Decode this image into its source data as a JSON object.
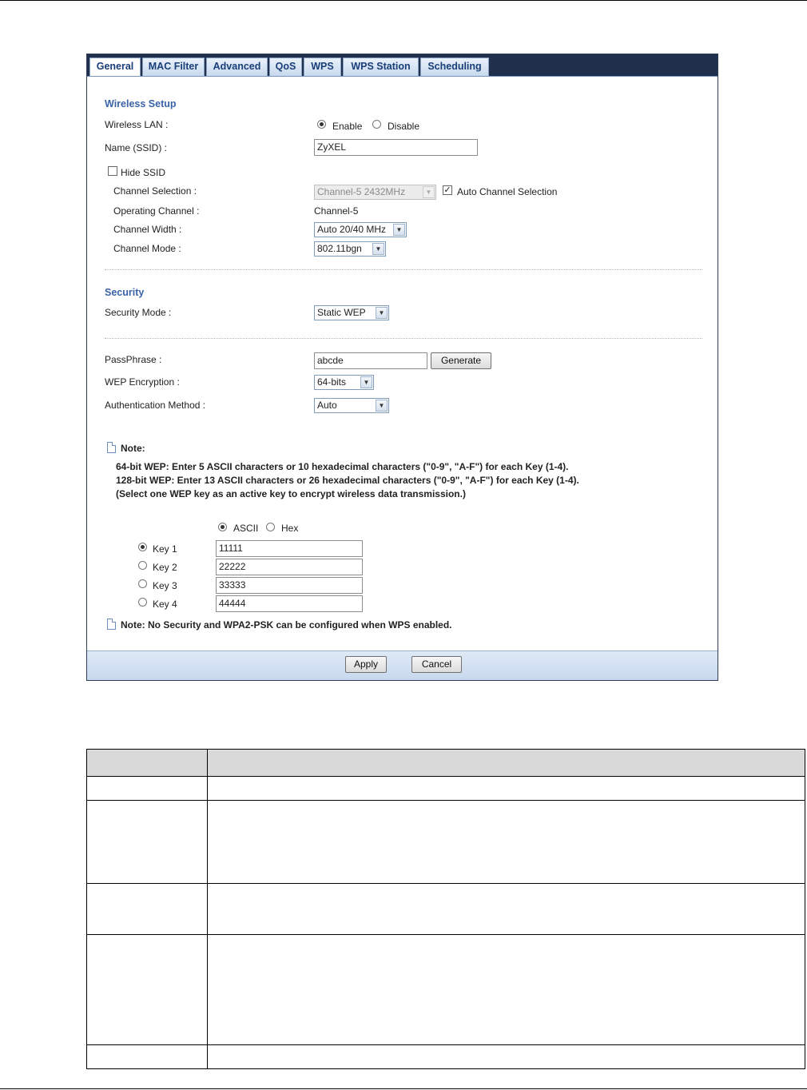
{
  "tabs": [
    {
      "label": "General",
      "active": true
    },
    {
      "label": "MAC Filter"
    },
    {
      "label": "Advanced"
    },
    {
      "label": "QoS"
    },
    {
      "label": "WPS"
    },
    {
      "label": "WPS Station"
    },
    {
      "label": "Scheduling"
    }
  ],
  "wireless_setup": {
    "title": "Wireless Setup",
    "wireless_lan_label": "Wireless LAN :",
    "enable_label": "Enable",
    "disable_label": "Disable",
    "wireless_lan_value": "Enable",
    "ssid_label": "Name (SSID) :",
    "ssid_value": "ZyXEL",
    "hide_ssid_label": "Hide SSID",
    "hide_ssid_checked": false,
    "channel_selection_label": "Channel Selection :",
    "channel_selection_value": "Channel-5 2432MHz",
    "auto_channel_label": "Auto Channel Selection",
    "auto_channel_checked": true,
    "operating_channel_label": "Operating Channel :",
    "operating_channel_value": "Channel-5",
    "channel_width_label": "Channel Width :",
    "channel_width_value": "Auto 20/40 MHz",
    "channel_mode_label": "Channel Mode :",
    "channel_mode_value": "802.11bgn"
  },
  "security": {
    "title": "Security",
    "security_mode_label": "Security Mode :",
    "security_mode_value": "Static WEP",
    "passphrase_label": "PassPhrase :",
    "passphrase_value": "abcde",
    "generate_label": "Generate",
    "wep_encryption_label": "WEP Encryption :",
    "wep_encryption_value": "64-bits",
    "auth_method_label": "Authentication Method :",
    "auth_method_value": "Auto"
  },
  "note": {
    "title": "Note:",
    "lines": [
      "64-bit WEP: Enter 5 ASCII characters or 10 hexadecimal characters (\"0-9\", \"A-F\") for each Key (1-4).",
      "128-bit WEP: Enter 13 ASCII characters or 26 hexadecimal characters (\"0-9\", \"A-F\") for each Key (1-4).",
      "(Select one WEP key as an active key to encrypt wireless data transmission.)"
    ]
  },
  "keys": {
    "ascii_label": "ASCII",
    "hex_label": "Hex",
    "format_selected": "ASCII",
    "items": [
      {
        "label": "Key 1",
        "value": "11111",
        "selected": true
      },
      {
        "label": "Key 2",
        "value": "22222",
        "selected": false
      },
      {
        "label": "Key 3",
        "value": "33333",
        "selected": false
      },
      {
        "label": "Key 4",
        "value": "44444",
        "selected": false
      }
    ]
  },
  "note2": "Note: No Security and WPA2-PSK can be configured when WPS enabled.",
  "footer": {
    "apply_label": "Apply",
    "cancel_label": "Cancel"
  }
}
